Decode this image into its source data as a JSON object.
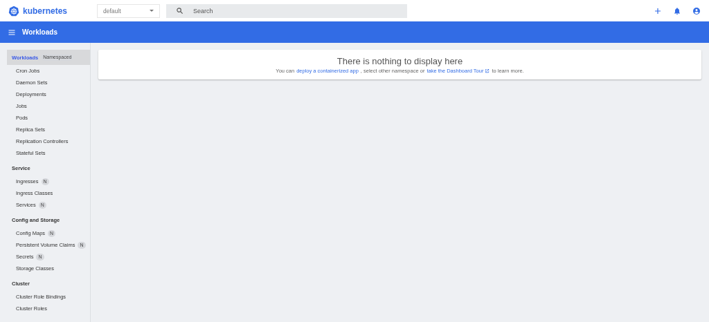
{
  "brand": {
    "name": "kubernetes"
  },
  "namespace": {
    "value": "default"
  },
  "search": {
    "placeholder": "Search"
  },
  "toolbar": {
    "title": "Workloads"
  },
  "sidebar": {
    "sections": [
      {
        "title": "Workloads",
        "badge": "Namespaced",
        "selected": true,
        "children": [
          {
            "label": "Cron Jobs"
          },
          {
            "label": "Daemon Sets"
          },
          {
            "label": "Deployments"
          },
          {
            "label": "Jobs"
          },
          {
            "label": "Pods"
          },
          {
            "label": "Replica Sets"
          },
          {
            "label": "Replication Controllers"
          },
          {
            "label": "Stateful Sets"
          }
        ]
      },
      {
        "title": "Service",
        "selected": false,
        "children": [
          {
            "label": "Ingresses",
            "badge": "N"
          },
          {
            "label": "Ingress Classes"
          },
          {
            "label": "Services",
            "badge": "N"
          }
        ]
      },
      {
        "title": "Config and Storage",
        "selected": false,
        "children": [
          {
            "label": "Config Maps",
            "badge": "N"
          },
          {
            "label": "Persistent Volume Claims",
            "badge": "N"
          },
          {
            "label": "Secrets",
            "badge": "N"
          },
          {
            "label": "Storage Classes"
          }
        ]
      },
      {
        "title": "Cluster",
        "selected": false,
        "children": [
          {
            "label": "Cluster Role Bindings"
          },
          {
            "label": "Cluster Roles"
          }
        ]
      }
    ]
  },
  "empty_state": {
    "title": "There is nothing to display here",
    "parts": [
      {
        "kind": "text",
        "text": "You can"
      },
      {
        "kind": "link",
        "text": "deploy a containerized app",
        "external": false
      },
      {
        "kind": "text",
        "text": ", select other namespace or"
      },
      {
        "kind": "link",
        "text": "take the Dashboard Tour",
        "external": true
      },
      {
        "kind": "text",
        "text": "to learn more."
      }
    ]
  }
}
